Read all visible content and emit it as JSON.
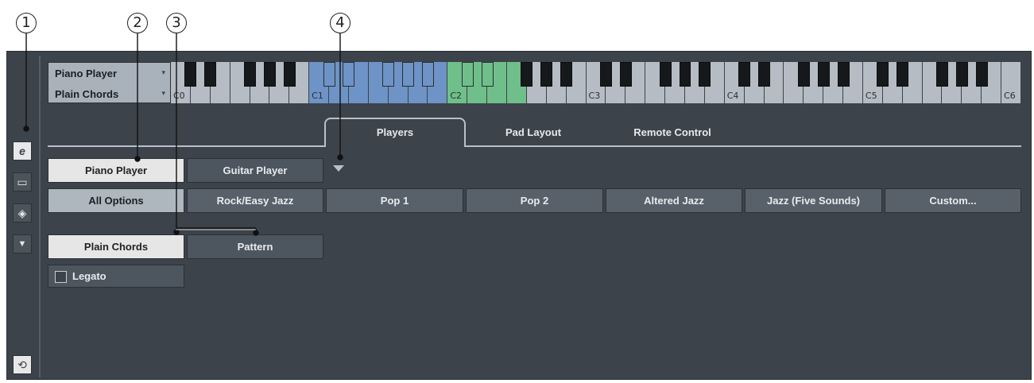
{
  "callouts": [
    "1",
    "2",
    "3",
    "4"
  ],
  "sidebar": {
    "buttons": [
      {
        "icon": "edit-icon",
        "glyph": "e"
      },
      {
        "icon": "chat-bubble-icon",
        "glyph": "▭"
      },
      {
        "icon": "tag-icon",
        "glyph": "◈"
      },
      {
        "icon": "dropdown-icon",
        "glyph": "▼"
      },
      {
        "icon": "reset-icon",
        "glyph": "⟲"
      }
    ]
  },
  "selector": {
    "player": "Piano Player",
    "style": "Plain Chords",
    "arrow": "▾"
  },
  "keyboard": {
    "octave_labels": [
      "C0",
      "C1",
      "C2",
      "C3",
      "C4",
      "C5",
      "C6"
    ],
    "colors": {
      "blue_range": "#6e93c6",
      "green_range": "#6fbf8a",
      "white": "#b5bcc3",
      "black": "#16191c"
    }
  },
  "tabs": [
    "Players",
    "Pad Layout",
    "Remote Control"
  ],
  "players": {
    "selected": "Piano Player",
    "other": "Guitar Player"
  },
  "styles": [
    "All Options",
    "Rock/Easy Jazz",
    "Pop 1",
    "Pop 2",
    "Altered Jazz",
    "Jazz (Five Sounds)",
    "Custom..."
  ],
  "modes": [
    "Plain Chords",
    "Pattern"
  ],
  "legato_label": "Legato"
}
